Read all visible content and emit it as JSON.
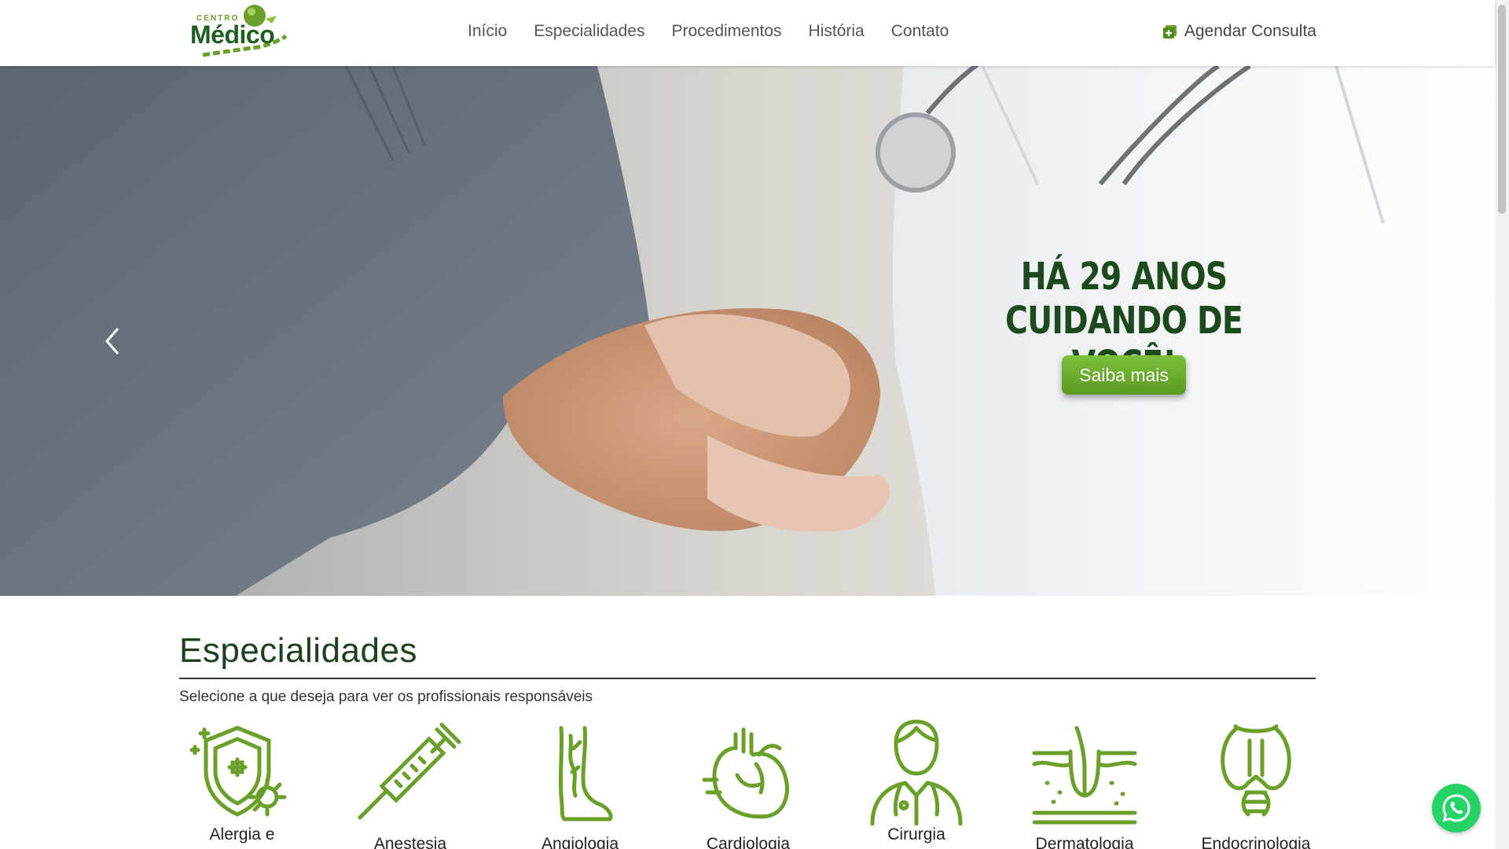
{
  "header": {
    "logo": {
      "small_text": "CENTRO",
      "main_text": "Médico"
    },
    "nav": [
      {
        "label": "Início"
      },
      {
        "label": "Especialidades"
      },
      {
        "label": "Procedimentos"
      },
      {
        "label": "História"
      },
      {
        "label": "Contato"
      }
    ],
    "cta": {
      "label": "Agendar Consulta",
      "icon": "calendar-plus-icon"
    }
  },
  "hero": {
    "headline_line1": "HÁ 29 ANOS",
    "headline_line2": "CUIDANDO DE VOCÊ!",
    "button_label": "Saiba mais",
    "prev_icon": "chevron-left-icon",
    "next_icon": "chevron-right-icon"
  },
  "specialties": {
    "title": "Especialidades",
    "subtitle": "Selecione a que deseja para ver os profissionais responsáveis",
    "items": [
      {
        "label": "Alergia e",
        "icon": "shield-virus-icon"
      },
      {
        "label": "Anestesia",
        "icon": "syringe-icon"
      },
      {
        "label": "Angiologia",
        "icon": "leg-veins-icon"
      },
      {
        "label": "Cardiologia",
        "icon": "heart-icon"
      },
      {
        "label": "Cirurgia",
        "icon": "doctor-icon"
      },
      {
        "label": "Dermatologia",
        "icon": "skin-layers-icon"
      },
      {
        "label": "Endocrinologia",
        "icon": "thyroid-icon"
      }
    ]
  },
  "colors": {
    "brand_green": "#5a9a22",
    "dark_green": "#1d4a1d",
    "icon_green": "#6aa02a",
    "whatsapp": "#25d366"
  }
}
